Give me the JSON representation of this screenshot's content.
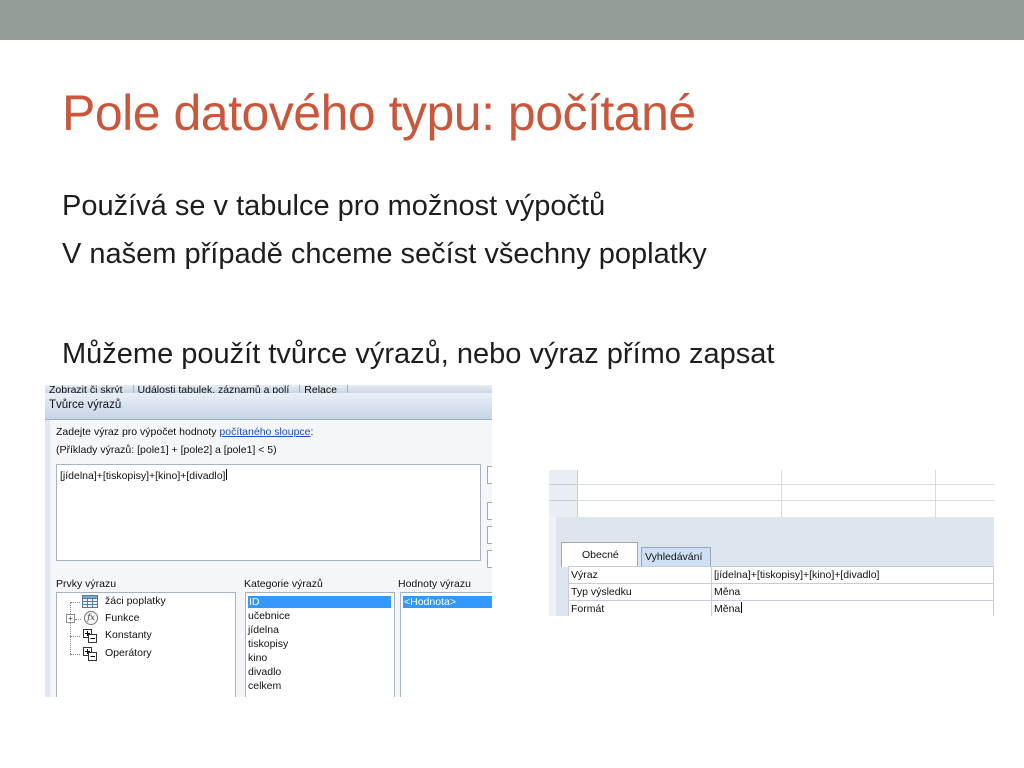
{
  "slide": {
    "title": "Pole datového typu: počítané",
    "lines": [
      "Používá se v tabulce pro možnost výpočtů",
      "V našem případě chceme sečíst všechny poplatky",
      "Můžeme použít tvůrce výrazů, nebo výraz přímo zapsat"
    ]
  },
  "colors": {
    "title": "#c9573b",
    "top_bar": "#929e98",
    "selection": "#3399ff",
    "link": "#1b4fc4"
  },
  "expression_builder": {
    "ribbon_tabs": [
      "Zobrazit či skrýt",
      "Události tabulek, záznamů a polí",
      "Relace"
    ],
    "window_title": "Tvůrce výrazů",
    "instruction_prefix": "Zadejte výraz pro výpočet hodnoty ",
    "instruction_link": "počítaného sloupce",
    "instruction_suffix": ":",
    "examples": "(Příklady výrazů: [pole1] + [pole2] a [pole1] < 5)",
    "expression": "[jídelna]+[tiskopisy]+[kino]+[divadlo]",
    "elements_label": "Prvky výrazu",
    "categories_label": "Kategorie výrazů",
    "values_label": "Hodnoty výrazu",
    "elements": [
      {
        "label": "žáci poplatky",
        "icon": "table-icon"
      },
      {
        "label": "Funkce",
        "icon": "function-icon"
      },
      {
        "label": "Konstanty",
        "icon": "constants-icon"
      },
      {
        "label": "Operátory",
        "icon": "operators-icon"
      }
    ],
    "categories": [
      "ID",
      "učebnice",
      "jídelna",
      "tiskopisy",
      "kino",
      "divadlo",
      "celkem"
    ],
    "selected_category": "ID",
    "values": [
      "<Hodnota>"
    ]
  },
  "field_properties": {
    "tabs": [
      "Obecné",
      "Vyhledávání"
    ],
    "active_tab": "Obecné",
    "rows": [
      {
        "key": "Výraz",
        "value": "[jídelna]+[tiskopisy]+[kino]+[divadlo]"
      },
      {
        "key": "Typ výsledku",
        "value": "Měna"
      },
      {
        "key": "Formát",
        "value": "Měna"
      }
    ]
  }
}
